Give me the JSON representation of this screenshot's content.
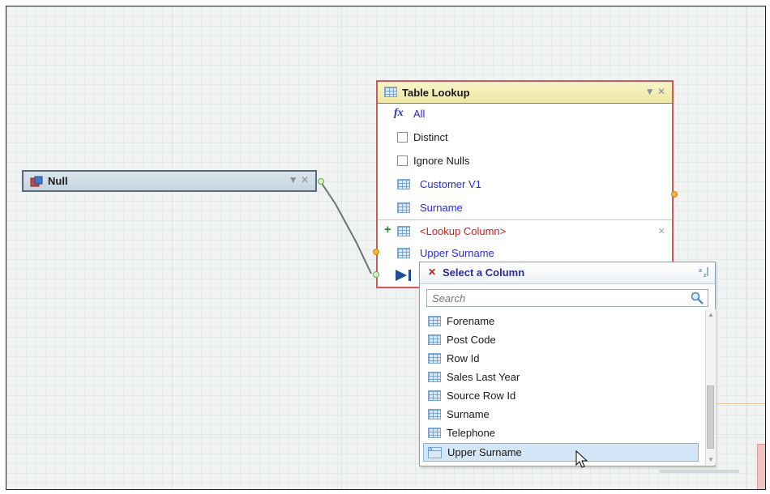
{
  "null_node": {
    "title": "Null",
    "controls": "▼ ✕"
  },
  "lookup_node": {
    "title": "Table Lookup",
    "controls": "▼ ✕",
    "fx_label": "All",
    "distinct_label": "Distinct",
    "ignore_nulls_label": "Ignore Nulls",
    "fields": [
      "Customer  V1",
      "Surname"
    ],
    "lookup_column_label": "<Lookup Column>",
    "upper_surname_label": "Upper Surname",
    "add_symbol": "+",
    "remove_symbol": "✕"
  },
  "popup": {
    "title": "Select a Column",
    "close_symbol": "✕",
    "search_placeholder": "Search",
    "items": [
      "Forename",
      "Post Code",
      "Row Id",
      "Sales Last Year",
      "Source Row Id",
      "Surname",
      "Telephone",
      "Upper Surname"
    ],
    "selected": "Upper Surname"
  },
  "colors": {
    "lookup_border": "#cc5a5a",
    "field_text": "#2a2ad0",
    "lookup_column_text": "#cc2020",
    "selection": "#d2e6f5"
  }
}
